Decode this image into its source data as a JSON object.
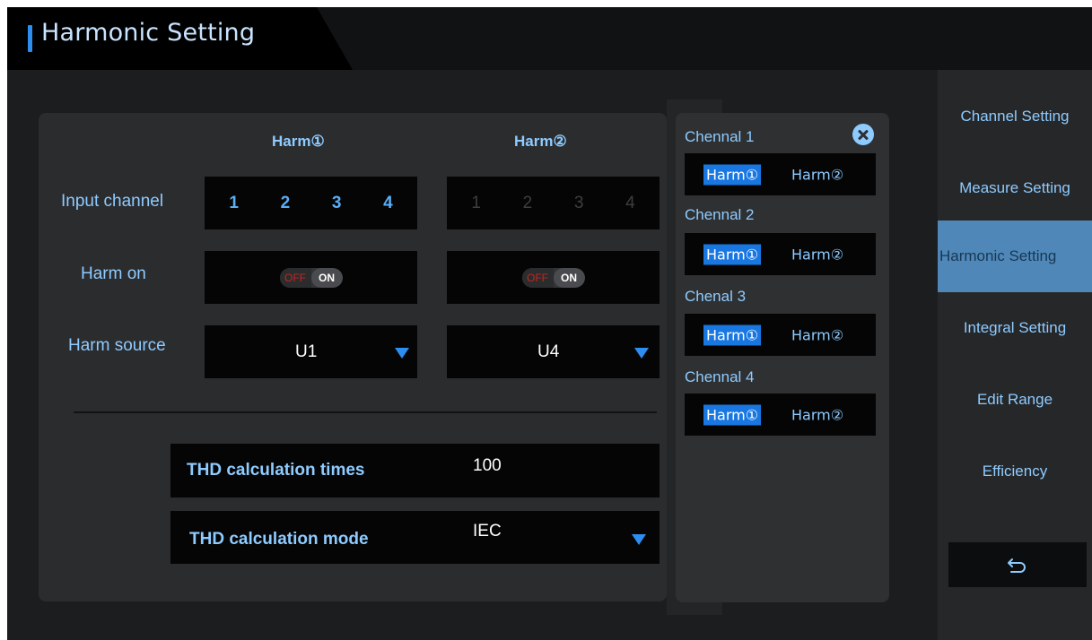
{
  "header": {
    "title": "Harmonic Setting"
  },
  "sidebar": {
    "items": [
      {
        "label": "Channel Setting"
      },
      {
        "label": "Measure Setting"
      },
      {
        "label": "Harmonic Setting"
      },
      {
        "label": "Integral Setting"
      },
      {
        "label": "Edit Range"
      },
      {
        "label": "Efficiency"
      }
    ],
    "active": "Harmonic Setting",
    "back_icon": "undo-arrow-icon"
  },
  "main": {
    "columns": [
      "Harm①",
      "Harm②"
    ],
    "labels": {
      "input_channel": "Input channel",
      "harm_on": "Harm on",
      "harm_source": "Harm source"
    },
    "channels": [
      "1",
      "2",
      "3",
      "4"
    ],
    "harm1": {
      "channels_enabled": true,
      "toggle_off": "OFF",
      "toggle_on": "ON",
      "source": "U1"
    },
    "harm2": {
      "channels_enabled": false,
      "toggle_off": "OFF",
      "toggle_on": "ON",
      "source": "U4"
    },
    "thd_times": {
      "label": "THD calculation times",
      "value": "100"
    },
    "thd_mode": {
      "label": "THD calculation mode",
      "value": "IEC"
    }
  },
  "popup": {
    "close_icon": "close-icon",
    "channels": [
      {
        "label": "Chennal 1",
        "opt1": "Harm①",
        "opt2": "Harm②",
        "selected": "Harm①"
      },
      {
        "label": "Chennal 2",
        "opt1": "Harm①",
        "opt2": "Harm②",
        "selected": "Harm①"
      },
      {
        "label": "Chenal 3",
        "opt1": "Harm①",
        "opt2": "Harm②",
        "selected": "Harm①"
      },
      {
        "label": "Chennal 4",
        "opt1": "Harm①",
        "opt2": "Harm②",
        "selected": "Harm①"
      }
    ]
  },
  "colors": {
    "accent": "#2d8ef0",
    "label": "#8ecbff",
    "active_sidebar": "#4f88b8",
    "toggle_off": "#c0281f"
  }
}
